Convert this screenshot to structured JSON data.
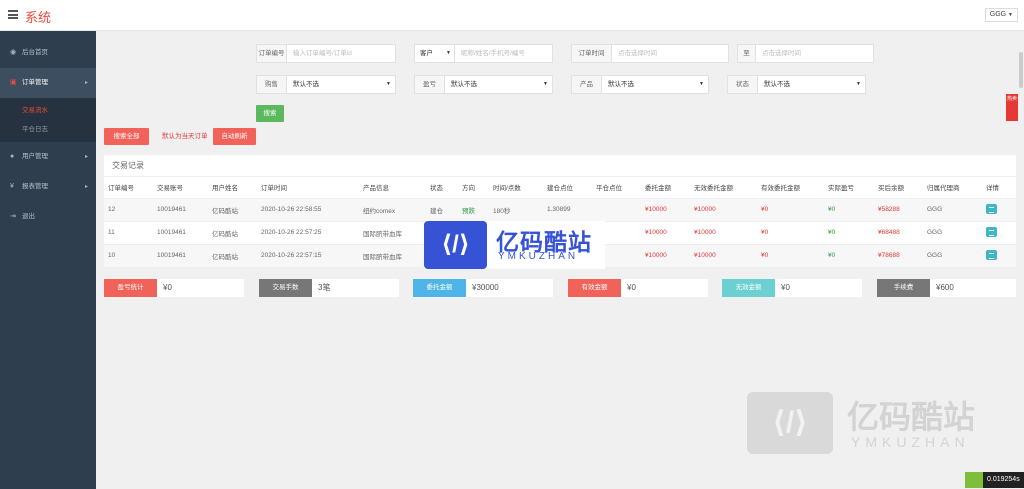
{
  "header": {
    "title": "系统",
    "user": "GGG"
  },
  "sidebar": {
    "items": [
      {
        "label": "后台首页",
        "icon": "dashboard-icon"
      },
      {
        "label": "订单管理",
        "icon": "order-icon",
        "sub": [
          "交易流水",
          "平仓日志"
        ]
      },
      {
        "label": "用户管理",
        "icon": "user-icon"
      },
      {
        "label": "报表管理",
        "icon": "report-icon"
      },
      {
        "label": "退出",
        "icon": "logout-icon"
      }
    ]
  },
  "filters": {
    "order_no_label": "订单编号",
    "order_no_placeholder": "输入订单编号/订单id",
    "customer_label": "客户",
    "customer_placeholder": "昵称/姓名/手机号/编号",
    "order_time_label": "订单时间",
    "time_placeholder": "点击选择时间",
    "to_label": "至",
    "buy_sell_label": "购售",
    "buy_sell_value": "默认不选",
    "profit_label": "盈亏",
    "profit_value": "默认不选",
    "product_label": "产品",
    "product_value": "默认不选",
    "status_label": "状态",
    "status_value": "默认不选",
    "search_button": "搜索"
  },
  "actions": {
    "search_all": "搜索全部",
    "default_note": "默认为当天订单",
    "auto_refresh": "自动刷新"
  },
  "table": {
    "title": "交易记录",
    "columns": [
      "订单编号",
      "交易账号",
      "用户姓名",
      "订单时间",
      "产品信息",
      "状态",
      "方向",
      "时间/点数",
      "建仓点位",
      "平仓点位",
      "委托金额",
      "无效委托金额",
      "有效委托金额",
      "实际盈亏",
      "买后余额",
      "归属代理商",
      "详情"
    ],
    "rows": [
      {
        "id": "12",
        "account": "10019461",
        "name": "亿码酷站",
        "time": "2020-10-26 22:58:55",
        "product": "纽约comex",
        "status": "建仓",
        "direction": "预跌",
        "duration": "180秒",
        "open": "1.30899",
        "close": "",
        "amount": "¥10000",
        "invalid": "¥10000",
        "valid": "¥0",
        "pnl": "¥0",
        "balance": "¥58288",
        "agent": "GGG"
      },
      {
        "id": "11",
        "account": "10019461",
        "name": "亿码酷站",
        "time": "2020-10-26 22:57:25",
        "product": "国际脐带血库",
        "status": "",
        "direction": "",
        "duration": "",
        "open": "",
        "close": "",
        "amount": "¥10000",
        "invalid": "¥10000",
        "valid": "¥0",
        "pnl": "¥0",
        "balance": "¥68488",
        "agent": "GGG"
      },
      {
        "id": "10",
        "account": "10019461",
        "name": "亿码酷站",
        "time": "2020-10-26 22:57:15",
        "product": "国际脐带血库",
        "status": "",
        "direction": "",
        "duration": "",
        "open": "",
        "close": "",
        "amount": "¥10000",
        "invalid": "¥10000",
        "valid": "¥0",
        "pnl": "¥0",
        "balance": "¥78688",
        "agent": "GGG"
      }
    ]
  },
  "stats": [
    {
      "label": "盈亏统计",
      "value": "¥0",
      "color": "#f0625a"
    },
    {
      "label": "交易手数",
      "value": "3笔",
      "color": "#777777"
    },
    {
      "label": "委托金额",
      "value": "¥30000",
      "color": "#4fb4e8"
    },
    {
      "label": "有效金额",
      "value": "¥0",
      "color": "#f0625a"
    },
    {
      "label": "无效金额",
      "value": "¥0",
      "color": "#6ccfd0"
    },
    {
      "label": "手续费",
      "value": "¥600",
      "color": "#777777"
    }
  ],
  "logo": {
    "main": "亿码酷站",
    "sub": "YMKUZHAN"
  },
  "hot_badge": "热卖",
  "timer": "0.019254s"
}
